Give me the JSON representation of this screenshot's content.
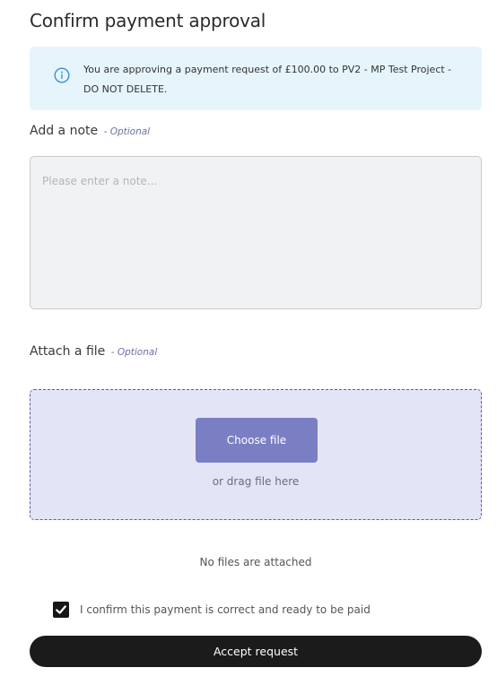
{
  "dialog": {
    "title": "Confirm payment approval"
  },
  "info": {
    "icon": "info-icon",
    "text": "You are approving a payment request of £100.00 to PV2 - MP Test Project - DO NOT DELETE."
  },
  "note": {
    "label": "Add a note",
    "optional": "- Optional",
    "placeholder": "Please enter a note...",
    "value": ""
  },
  "attachment": {
    "label": "Attach a file",
    "optional": "- Optional",
    "choose_label": "Choose file",
    "drag_text": "or drag file here",
    "status": "No files are attached"
  },
  "confirm": {
    "checked": true,
    "text": "I confirm this payment is correct and ready to be paid"
  },
  "actions": {
    "accept_label": "Accept request"
  },
  "colors": {
    "info_background": "#e6f5fc",
    "info_icon": "#3a8fd8",
    "drop_zone_background": "#e3e4f6",
    "choose_button": "#7a7fc4",
    "accept_button": "#1b1b1b"
  }
}
